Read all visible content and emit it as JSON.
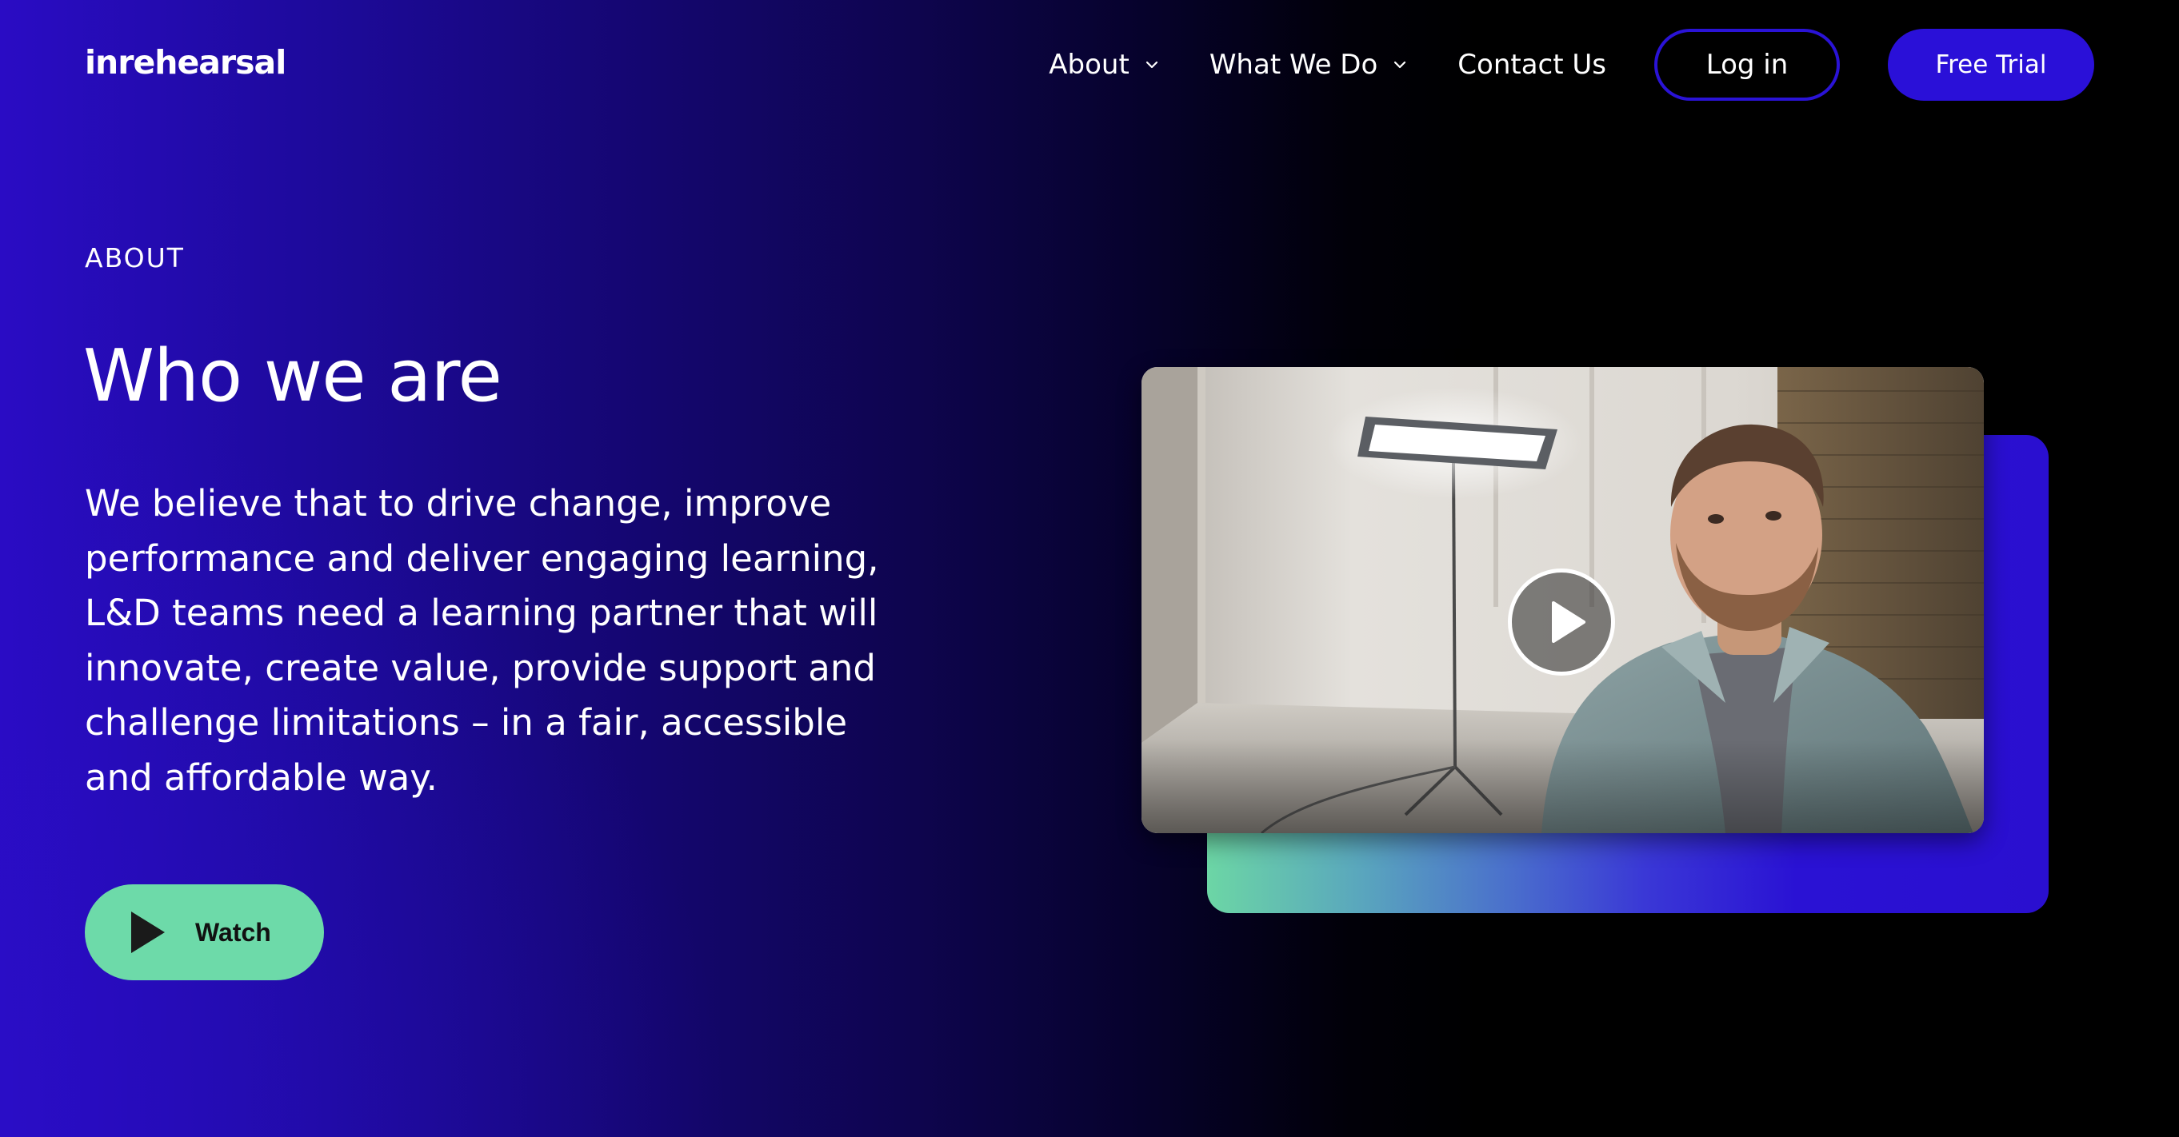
{
  "brand": {
    "logo_text": "inrehearsal"
  },
  "nav": {
    "items": [
      {
        "label": "About",
        "has_dropdown": true
      },
      {
        "label": "What We Do",
        "has_dropdown": true
      },
      {
        "label": "Contact Us",
        "has_dropdown": false
      }
    ],
    "login_label": "Log in",
    "trial_label": "Free Trial"
  },
  "hero": {
    "eyebrow": "ABOUT",
    "title": "Who we are",
    "body": "We believe that to drive change, improve performance and deliver engaging learning, L&D teams need a learning partner that will innovate, create value, provide support and challenge limitations – in a fair, accessible and affordable way.",
    "watch_label": "Watch"
  },
  "media": {
    "play_icon": "play-icon",
    "thumbnail_subject": "man seated in a white room in front of a studio light"
  },
  "colors": {
    "accent_blue": "#2a10d8",
    "accent_green": "#6ddaa9",
    "background_dark": "#000000"
  }
}
